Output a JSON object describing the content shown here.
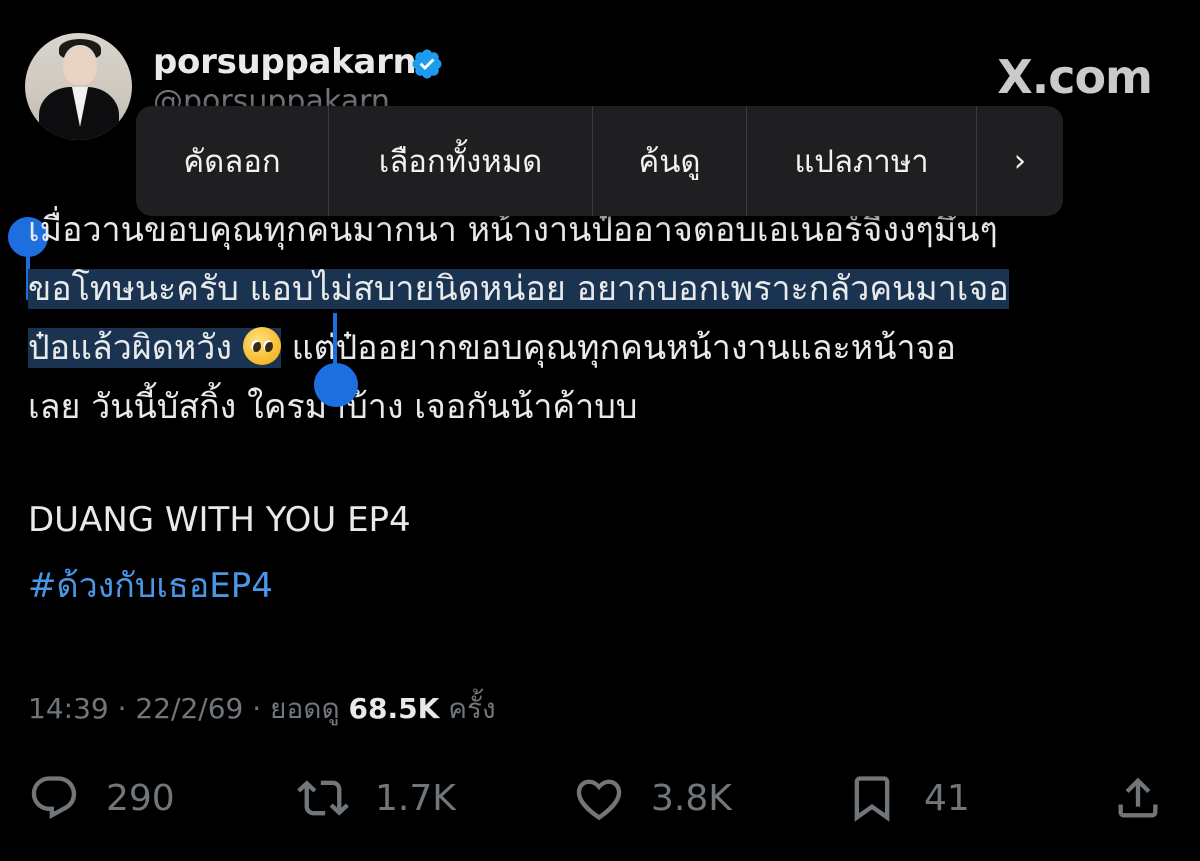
{
  "header": {
    "display_name": "porsuppakarn",
    "handle": "@porsuppakarn",
    "brand": "X.com"
  },
  "context_menu": {
    "items": [
      "คัดลอก",
      "เลือกทั้งหมด",
      "ค้นดู",
      "แปลภาษา",
      "›"
    ]
  },
  "tweet": {
    "line1": "เมื่อวานขอบคุณทุกคนมากนา หน้างานป๋ออาจตอบเอเนอร์จี้งงๆมึนๆ",
    "line2": "ขอโทษนะครับ แอบไม่สบายนิดหน่อย อยากบอกเพราะกลัวคนมาเจอ",
    "line3a": "ป๋อแล้วผิดหวัง",
    "line3b": "แต่ป๋ออยากขอบคุณทุกคนหน้างานและหน้าจอ",
    "line4": "เลย วันนี้บัสกิ้ง ใครมาบ้าง เจอกันน้าค้าบบ",
    "title": "DUANG WITH YOU EP4",
    "hashtag": "#ด้วงกับเธอEP4",
    "emoji": "pleading-face-emoji"
  },
  "meta": {
    "time_date": "14:39 · 22/2/69 · ยอดดู",
    "views": "68.5K",
    "views_suffix": "ครั้ง"
  },
  "actions": {
    "replies": "290",
    "reposts": "1.7K",
    "likes": "3.8K",
    "bookmarks": "41"
  },
  "colors": {
    "background": "#000000",
    "text": "#e7e9ea",
    "secondary": "#71767b",
    "link": "#4a97e8",
    "verified": "#1d9bf0",
    "selection": "#1d6fe0"
  }
}
